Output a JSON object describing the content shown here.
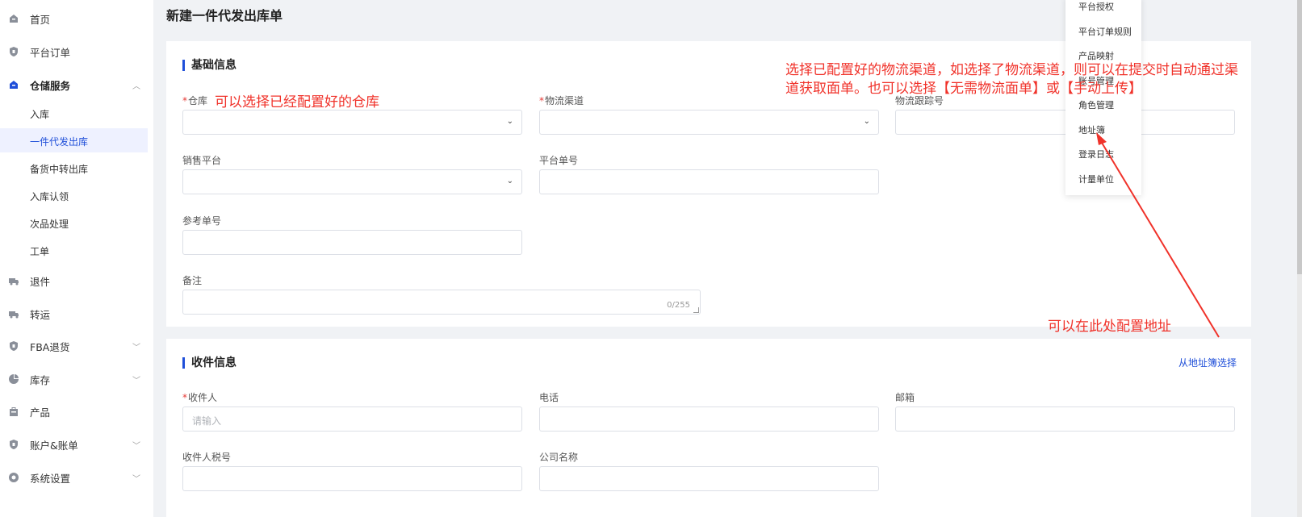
{
  "page_title": "新建一件代发出库单",
  "sidebar": {
    "items": [
      {
        "label": "首页"
      },
      {
        "label": "平台订单"
      },
      {
        "label": "仓储服务"
      },
      {
        "label": "退件"
      },
      {
        "label": "转运"
      },
      {
        "label": "FBA退货"
      },
      {
        "label": "库存"
      },
      {
        "label": "产品"
      },
      {
        "label": "账户&账单"
      },
      {
        "label": "系统设置"
      }
    ],
    "sub_items": [
      {
        "label": "入库"
      },
      {
        "label": "一件代发出库"
      },
      {
        "label": "备货中转出库"
      },
      {
        "label": "入库认领"
      },
      {
        "label": "次品处理"
      },
      {
        "label": "工单"
      }
    ]
  },
  "basic_info": {
    "title": "基础信息",
    "warehouse_label": "仓库",
    "channel_label": "物流渠道",
    "tracking_label": "物流跟踪号",
    "platform_label": "销售平台",
    "platform_order_label": "平台单号",
    "reference_label": "参考单号",
    "remark_label": "备注",
    "remark_counter": "0/255"
  },
  "receiver_info": {
    "title": "收件信息",
    "address_book_link": "从地址簿选择",
    "receiver_label": "收件人",
    "receiver_placeholder": "请输入",
    "phone_label": "电话",
    "email_label": "邮箱",
    "tax_label": "收件人税号",
    "company_label": "公司名称"
  },
  "dropdown_menu": {
    "items": [
      {
        "label": "平台授权"
      },
      {
        "label": "平台订单规则"
      },
      {
        "label": "产品映射"
      },
      {
        "label": "账号管理"
      },
      {
        "label": "角色管理"
      },
      {
        "label": "地址簿"
      },
      {
        "label": "登录日志"
      },
      {
        "label": "计量单位"
      }
    ]
  },
  "annotations": {
    "warehouse_note": "可以选择已经配置好的仓库",
    "channel_note_line1": "选择已配置好的物流渠道，如选择了物流渠道，则可以在提交时自动通过渠",
    "channel_note_line2": "道获取面单。也可以选择【无需物流面单】或【手动上传】",
    "address_note": "可以在此处配置地址"
  },
  "colors": {
    "accent": "#1f4fd9",
    "annotation": "#f0322a",
    "required": "#e53935"
  }
}
